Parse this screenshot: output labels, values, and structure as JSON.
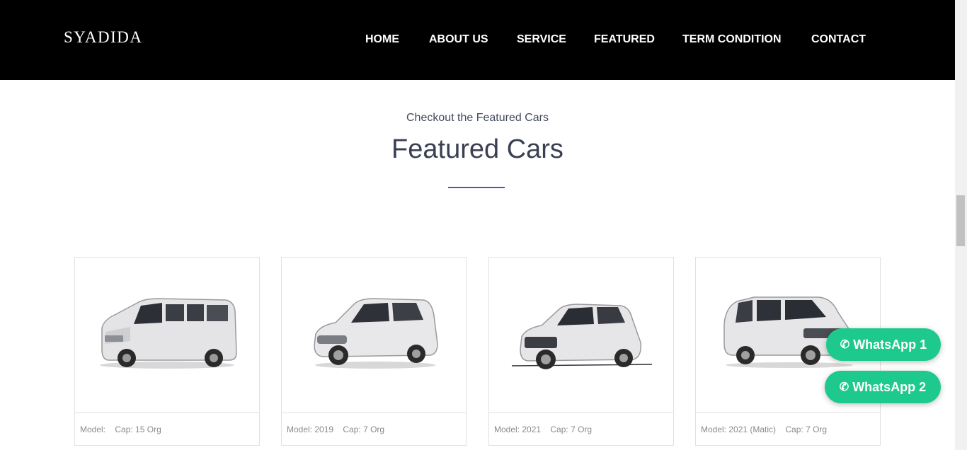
{
  "header": {
    "logo": "SYADIDA",
    "nav": [
      {
        "label": "HOME"
      },
      {
        "label": "ABOUT US"
      },
      {
        "label": "SERVICE"
      },
      {
        "label": "FEATURED"
      },
      {
        "label": "TERM CONDITION"
      },
      {
        "label": "CONTACT"
      }
    ]
  },
  "section": {
    "subtitle": "Checkout the Featured Cars",
    "title": "Featured Cars"
  },
  "cars": [
    {
      "model": "Model:",
      "cap": "Cap: 15 Org",
      "icon": "van-image"
    },
    {
      "model": "Model: 2019",
      "cap": "Cap: 7 Org",
      "icon": "mpv-image"
    },
    {
      "model": "Model: 2021",
      "cap": "Cap: 7 Org",
      "icon": "suv-image"
    },
    {
      "model": "Model: 2021 (Matic)",
      "cap": "Cap: 7 Org",
      "icon": "mpv-image"
    }
  ],
  "whatsapp": [
    {
      "label": "WhatsApp 1"
    },
    {
      "label": "WhatsApp 2"
    }
  ],
  "colors": {
    "header_bg": "#000000",
    "accent": "#4b55c8",
    "whatsapp": "#1ec98e"
  }
}
